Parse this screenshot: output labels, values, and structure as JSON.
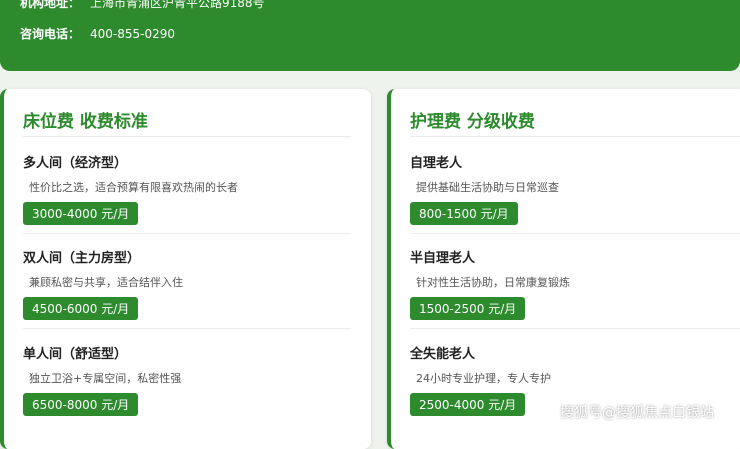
{
  "header": {
    "address_label": "机构地址：",
    "address_value": "上海市青浦区沪青平公路9188号",
    "phone_label": "咨询电话：",
    "phone_value": "400-855-0290"
  },
  "bed_fee": {
    "title": "床位费 收费标准",
    "items": [
      {
        "name": "多人间（经济型）",
        "desc": "性价比之选，适合预算有限喜欢热闹的长者",
        "price": "3000-4000 元/月"
      },
      {
        "name": "双人间（主力房型）",
        "desc": "兼顾私密与共享，适合结伴入住",
        "price": "4500-6000 元/月"
      },
      {
        "name": "单人间（舒适型）",
        "desc": "独立卫浴+专属空间，私密性强",
        "price": "6500-8000 元/月"
      }
    ]
  },
  "care_fee": {
    "title": "护理费 分级收费",
    "items": [
      {
        "name": "自理老人",
        "desc": "提供基础生活协助与日常巡查",
        "price": "800-1500 元/月"
      },
      {
        "name": "半自理老人",
        "desc": "针对性生活协助，日常康复锻炼",
        "price": "1500-2500 元/月"
      },
      {
        "name": "全失能老人",
        "desc": "24小时专业护理，专人专护",
        "price": "2500-4000 元/月"
      }
    ]
  },
  "watermark": "搜狐号@搜狐焦点白银站",
  "colors": {
    "brand_green": "#2d8a2d",
    "card_bg": "#ffffff",
    "page_bg": "#eef3ee"
  }
}
